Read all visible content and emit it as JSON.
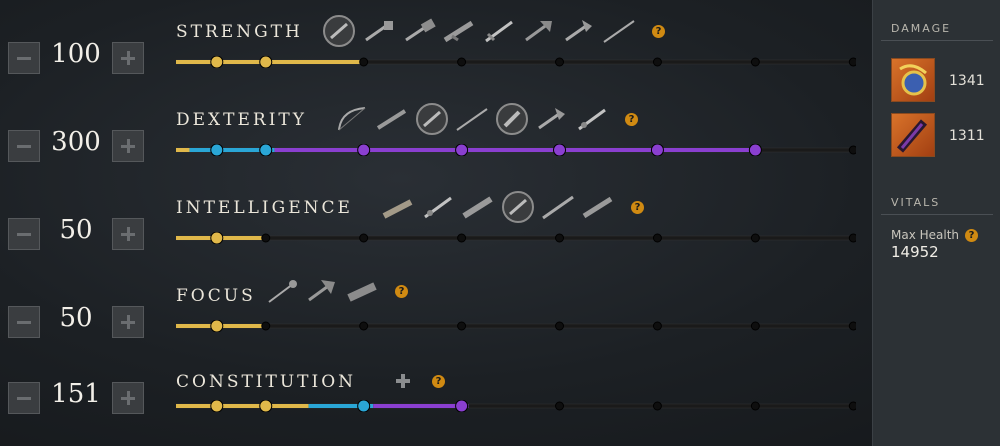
{
  "attributes": [
    {
      "name": "STRENGTH",
      "value": "100",
      "weapons": [
        "shield-icon",
        "war-hammer-icon",
        "sledge-hammer-icon",
        "musket-icon",
        "sword-icon",
        "great-axe-icon",
        "hatchet-icon",
        "spear-icon"
      ],
      "fill": {
        "yellow": 0.27,
        "blue": 0.27,
        "purple": 0.27
      }
    },
    {
      "name": "DEXTERITY",
      "value": "300",
      "weapons": [
        "bow-icon",
        "musket-icon",
        "round-shield-icon",
        "spear-icon",
        "shield-icon",
        "hatchet-icon",
        "rapier-icon"
      ],
      "fill": {
        "yellow": 0.02,
        "blue": 0.145,
        "purple": 0.855
      }
    },
    {
      "name": "INTELLIGENCE",
      "value": "50",
      "weapons": [
        "fire-staff-icon",
        "rapier-icon",
        "blunderbuss-icon",
        "round-shield-icon",
        "spear-icon",
        "musket-icon"
      ],
      "fill": {
        "yellow": 0.13,
        "blue": 0.13,
        "purple": 0.13
      }
    },
    {
      "name": "FOCUS",
      "value": "50",
      "weapons": [
        "life-staff-icon",
        "great-axe-icon",
        "void-gauntlet-icon"
      ],
      "fill": {
        "yellow": 0.13,
        "blue": 0.13,
        "purple": 0.13
      }
    },
    {
      "name": "CONSTITUTION",
      "value": "151",
      "weapons": [],
      "fill": {
        "yellow": 0.195,
        "blue": 0.29,
        "purple": 0.43
      }
    }
  ],
  "sidebar": {
    "damage_heading": "DAMAGE",
    "damage": [
      {
        "icon": "fire-gauntlet-icon",
        "value": "1341"
      },
      {
        "icon": "void-blade-icon",
        "value": "1311"
      }
    ],
    "vitals_heading": "VITALS",
    "max_health_label": "Max Health",
    "max_health_value": "14952"
  },
  "help_symbol": "?",
  "colors": {
    "yellow": "#e0b84a",
    "blue": "#2aa6d6",
    "purple": "#8a3fd0",
    "track": "#1a1a1a",
    "dot": "#0e0e0e"
  }
}
